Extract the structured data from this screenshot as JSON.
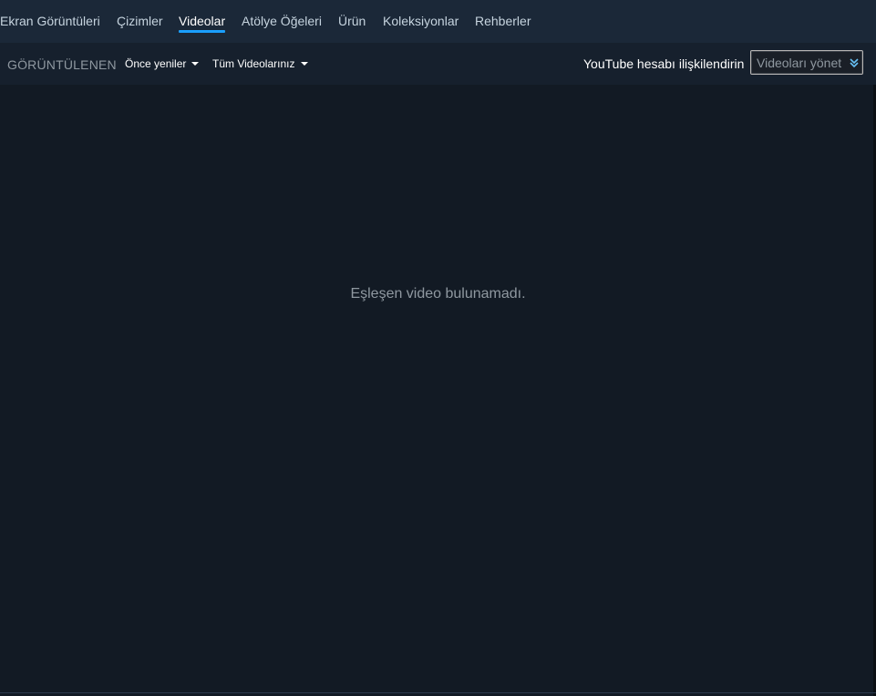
{
  "tabs": [
    {
      "label": "Ekran Görüntüleri",
      "active": false
    },
    {
      "label": "Çizimler",
      "active": false
    },
    {
      "label": "Videolar",
      "active": true
    },
    {
      "label": "Atölye Öğeleri",
      "active": false
    },
    {
      "label": "Ürün",
      "active": false
    },
    {
      "label": "Koleksiyonlar",
      "active": false
    },
    {
      "label": "Rehberler",
      "active": false
    }
  ],
  "filters": {
    "viewing_label": "GÖRÜNTÜLENEN",
    "sort_value": "Önce yeniler",
    "scope_value": "Tüm Videolarınız"
  },
  "youtube": {
    "link_label": "YouTube hesabı ilişkilendirin",
    "manage_value": "Videoları yönet"
  },
  "content": {
    "empty_message": "Eşleşen video bulunamadı."
  },
  "colors": {
    "accent": "#1a9fff",
    "background": "#121a24",
    "tabbar": "#1b2838"
  },
  "icons": {
    "dropdown": "caret-down-icon",
    "manage": "double-chevron-down-icon"
  }
}
